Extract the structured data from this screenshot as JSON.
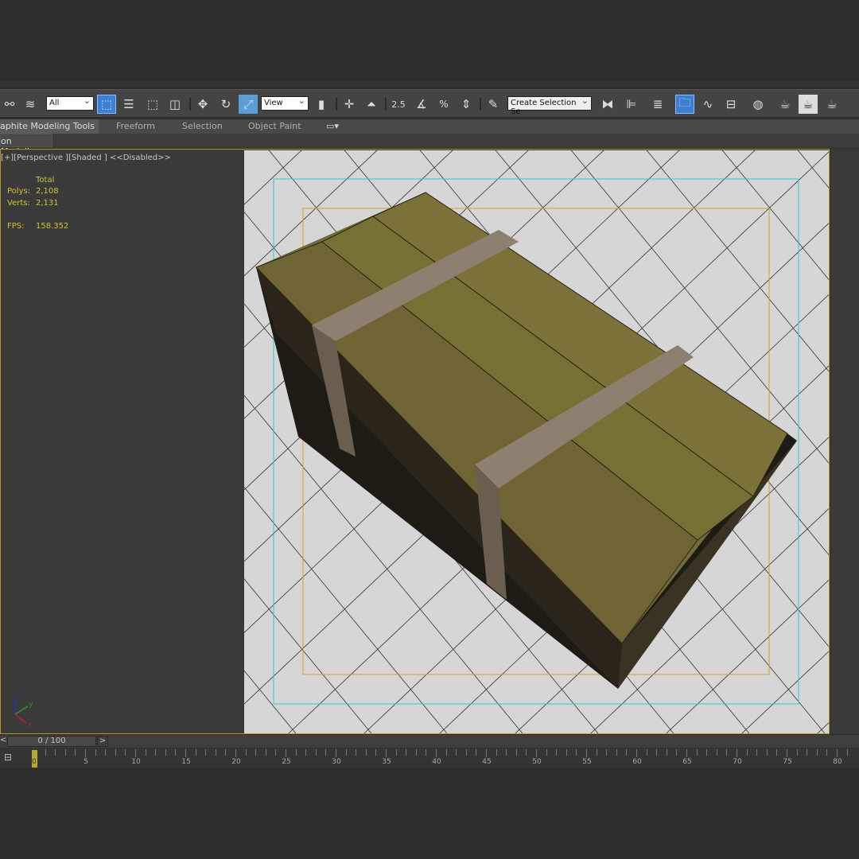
{
  "toolbar": {
    "selection_filter": "All",
    "ref_coord": "View",
    "snap_angle": "2.5",
    "named_selection": "Create Selection Se"
  },
  "ribbon": {
    "tabs": [
      "aphite Modeling Tools",
      "Freeform",
      "Selection",
      "Object Paint"
    ],
    "sub_tab": "on Modeling"
  },
  "viewport": {
    "label_plus": "[+]",
    "label_view": "[Perspective ]",
    "label_shade": "[Shaded ]",
    "label_disabled": "<<Disabled>>",
    "stats": {
      "header": "Total",
      "polys_label": "Polys:",
      "polys": "2,108",
      "verts_label": "Verts:",
      "verts": "2,131",
      "fps_label": "FPS:",
      "fps": "158.352"
    }
  },
  "axis": {
    "x": "x",
    "y": "y",
    "z": "z"
  },
  "timeline": {
    "position": "0 / 100",
    "prev": "<",
    "next": ">",
    "current_frame": "0",
    "labels": [
      "5",
      "10",
      "15",
      "20",
      "25",
      "30",
      "35",
      "40",
      "45",
      "50",
      "55",
      "60",
      "65",
      "70",
      "75",
      "80"
    ]
  },
  "colors": {
    "accent": "#3d7fd6",
    "stats": "#d4c234",
    "safe_frame": "#33c8d0",
    "render_frame": "#d8a020"
  }
}
